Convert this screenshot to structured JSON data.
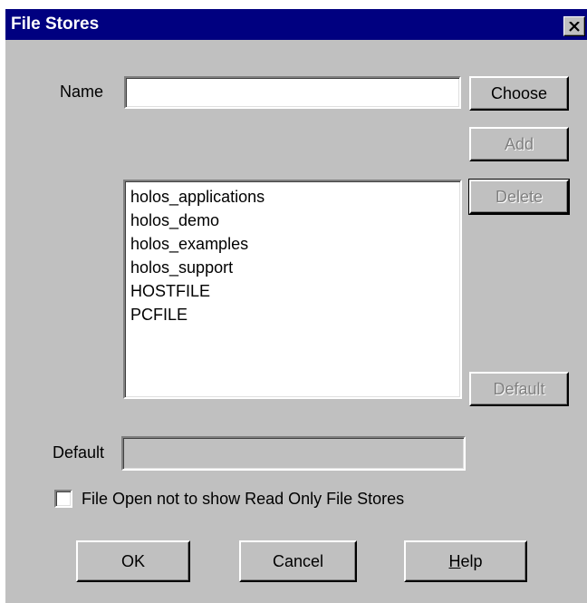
{
  "window": {
    "title": "File Stores",
    "close_icon": "close-icon"
  },
  "name_field": {
    "label": "Name",
    "value": ""
  },
  "buttons": {
    "choose": "Choose",
    "add": "Add",
    "delete": "Delete",
    "default": "Default",
    "ok": "OK",
    "cancel": "Cancel",
    "help_mnemonic": "H",
    "help_rest": "elp"
  },
  "file_stores": [
    "holos_applications",
    "holos_demo",
    "holos_examples",
    "holos_support",
    "HOSTFILE",
    "PCFILE"
  ],
  "default_field": {
    "label": "Default",
    "value": ""
  },
  "read_only_option": {
    "label": "File Open not to show Read Only File Stores",
    "checked": false
  },
  "colors": {
    "titlebar": "#000080",
    "face": "#c0c0c0",
    "disabled_text": "#808080"
  }
}
